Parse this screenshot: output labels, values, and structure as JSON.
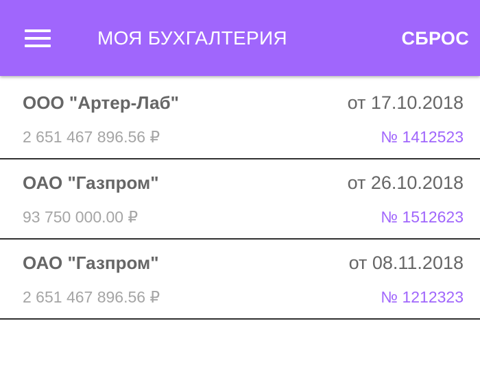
{
  "appbar": {
    "title": "МОЯ БУХГАЛТЕРИЯ",
    "reset_label": "СБРОС",
    "menu_icon": "hamburger-menu-icon",
    "color": "#a066fc"
  },
  "documents": [
    {
      "company": "ООО \"Артер-Лаб\"",
      "date": "от 17.10.2018",
      "amount": "2 651 467 896.56 ₽",
      "number": "№ 1412523"
    },
    {
      "company": "ОАО \"Газпром\"",
      "date": "от 26.10.2018",
      "amount": "93 750 000.00 ₽",
      "number": "№ 1512623"
    },
    {
      "company": "ОАО \"Газпром\"",
      "date": "от 08.11.2018",
      "amount": "2 651 467 896.56 ₽",
      "number": "№ 1212323"
    }
  ]
}
